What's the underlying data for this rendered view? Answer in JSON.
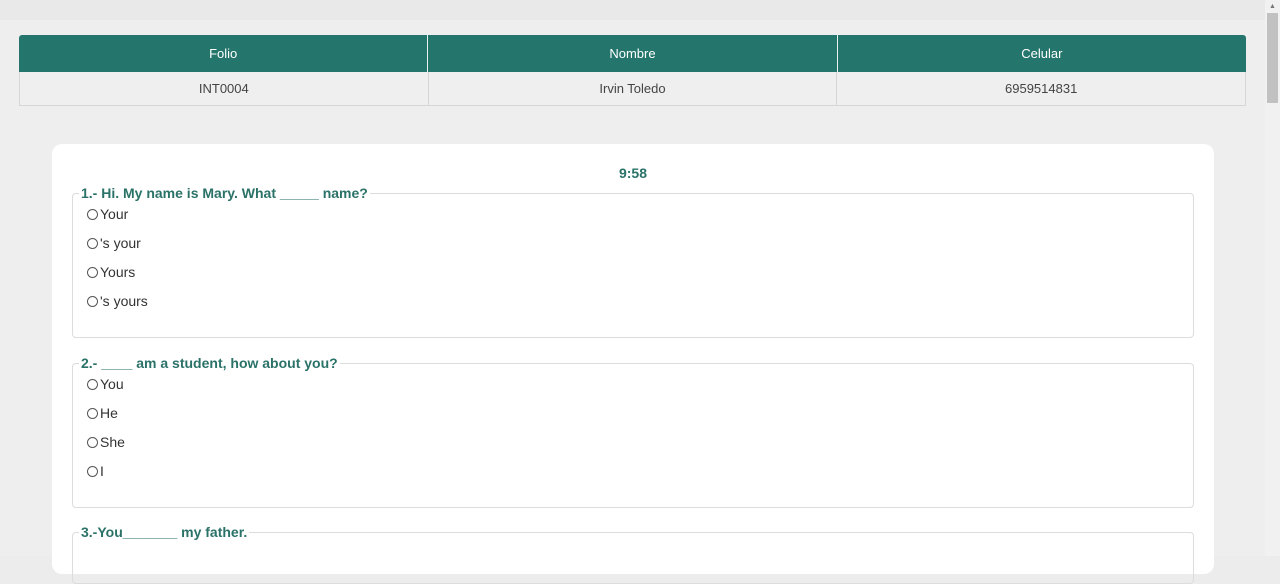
{
  "info": {
    "headers": [
      "Folio",
      "Nombre",
      "Celular"
    ],
    "row": [
      "INT0004",
      "Irvin Toledo",
      "6959514831"
    ]
  },
  "timer": "9:58",
  "questions": [
    {
      "title": "1.- Hi. My name is Mary. What _____ name?",
      "options": [
        "Your",
        "'s your",
        "Yours",
        "'s yours"
      ]
    },
    {
      "title": "2.- ____ am a student, how about you?",
      "options": [
        "You",
        "He",
        "She",
        "I"
      ]
    },
    {
      "title": "3.-You_______ my father.",
      "options": []
    }
  ],
  "colors": {
    "accent": "#24756b",
    "accent_text": "#2a7268",
    "background": "#eeeeee"
  }
}
